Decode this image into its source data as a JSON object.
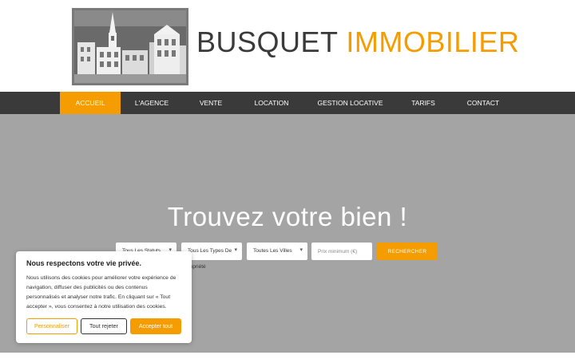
{
  "brand": {
    "part1": "BUSQUET",
    "part2": "IMMOBILIER",
    "accent_color": "#f59c00",
    "dark_color": "#3a3a3a"
  },
  "nav": {
    "items": [
      {
        "label": "ACCUEIL",
        "active": true
      },
      {
        "label": "L'AGENCE"
      },
      {
        "label": "VENTE"
      },
      {
        "label": "LOCATION"
      },
      {
        "label": "GESTION LOCATIVE"
      },
      {
        "label": "TARIFS"
      },
      {
        "label": "CONTACT"
      }
    ]
  },
  "hero": {
    "title": "Trouvez votre bien !",
    "search": {
      "status_select": "Tous Les Statuts",
      "type_select": "Tous Les Types De",
      "city_select": "Toutes Les Villes",
      "price_placeholder": "Prix minimum (€)",
      "button": "RECHERCHER",
      "link": "propriété"
    }
  },
  "cookie": {
    "title": "Nous respectons votre vie privée.",
    "text": "Nous utilisons des cookies pour améliorer votre expérience de navigation, diffuser des publicités ou des contenus personnalisés et analyser notre trafic. En cliquant sur « Tout accepter », vous consentez à notre utilisation des cookies.",
    "customize": "Personnaliser",
    "reject": "Tout rejeter",
    "accept": "Accepter tout"
  }
}
